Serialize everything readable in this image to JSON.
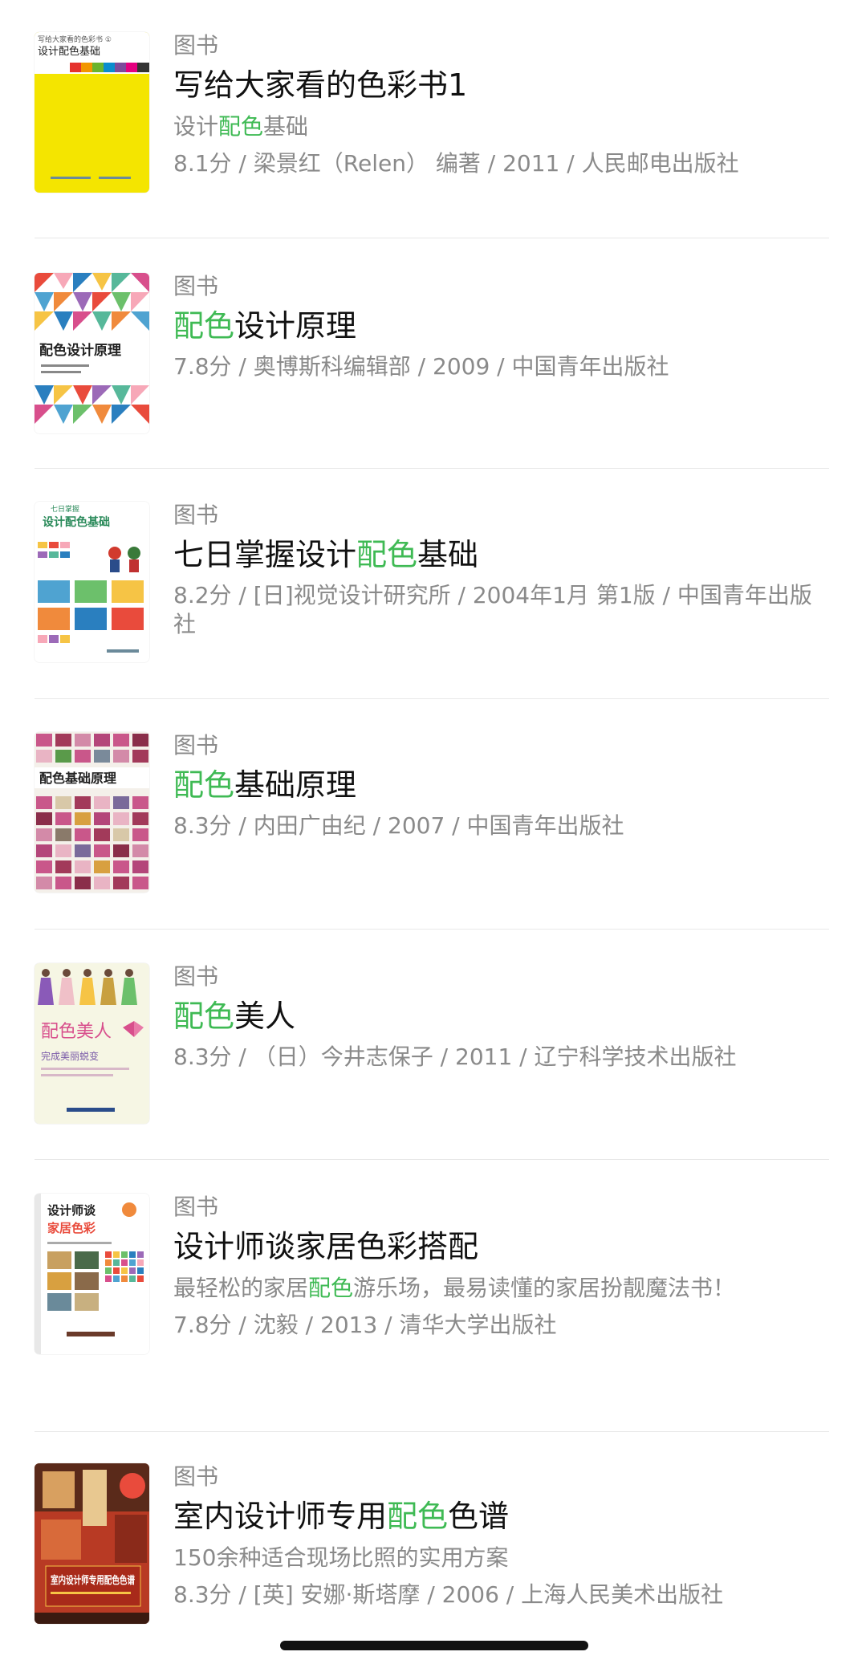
{
  "results": [
    {
      "type": "图书",
      "title": {
        "pre": "写给大家看的色彩书1",
        "hl": "",
        "post": ""
      },
      "subtitle": {
        "pre": "设计",
        "hl": "配色",
        "post": "基础"
      },
      "meta": "8.1分 / 梁景红（Relen）  编著 / 2011 / 人民邮电出版社",
      "cover": {
        "title": "设计配色基础",
        "series": "写给大家看的色彩书 ①",
        "bg": "#f5e600"
      }
    },
    {
      "type": "图书",
      "title": {
        "pre": "",
        "hl": "配色",
        "post": "设计原理"
      },
      "subtitle": null,
      "meta": "7.8分 / 奥博斯科编辑部 / 2009 / 中国青年出版社",
      "cover": {
        "title": "配色设计原理",
        "bg": "#ffffff"
      }
    },
    {
      "type": "图书",
      "title": {
        "pre": "七日掌握设计",
        "hl": "配色",
        "post": "基础"
      },
      "subtitle": null,
      "meta": "8.2分 / [日]视觉设计研究所 / 2004年1月 第1版 / 中国青年出版社",
      "cover": {
        "title": "设计配色基础",
        "series": "七日掌握",
        "bg": "#ffffff"
      }
    },
    {
      "type": "图书",
      "title": {
        "pre": "",
        "hl": "配色",
        "post": "基础原理"
      },
      "subtitle": null,
      "meta": "8.3分 / 内田广由纪 / 2007 / 中国青年出版社",
      "cover": {
        "title": "配色基础原理",
        "bg": "#c9578a"
      }
    },
    {
      "type": "图书",
      "title": {
        "pre": "",
        "hl": "配色",
        "post": "美人"
      },
      "subtitle": null,
      "meta": "8.3分 / （日）今井志保子 / 2011 / 辽宁科学技术出版社",
      "cover": {
        "title": "配色美人",
        "tagline": "完成美丽蜕变",
        "bg": "#f6f6e4"
      }
    },
    {
      "type": "图书",
      "title": {
        "pre": "设计师谈家居色彩搭配",
        "hl": "",
        "post": ""
      },
      "subtitle": {
        "pre": "最轻松的家居",
        "hl": "配色",
        "post": "游乐场，最易读懂的家居扮靓魔法书！"
      },
      "meta": "7.8分 / 沈毅 / 2013 / 清华大学出版社",
      "cover": {
        "title": "家居色彩",
        "series": "设计师谈",
        "bg": "#ffffff"
      }
    },
    {
      "type": "图书",
      "title": {
        "pre": "室内设计师专用",
        "hl": "配色",
        "post": "色谱"
      },
      "subtitle": {
        "pre": "150余种适合现场比照的实用方案",
        "hl": "",
        "post": ""
      },
      "meta": "8.3分 / [英] 安娜·斯塔摩 / 2006 / 上海人民美术出版社",
      "cover": {
        "title": "室内设计师专用配色色谱",
        "bg": "#b83a24"
      }
    }
  ],
  "colors": {
    "highlight": "#3fba54",
    "secondary_text": "#8a8a8a",
    "primary_text": "#111111",
    "divider": "#e8e8e8"
  }
}
